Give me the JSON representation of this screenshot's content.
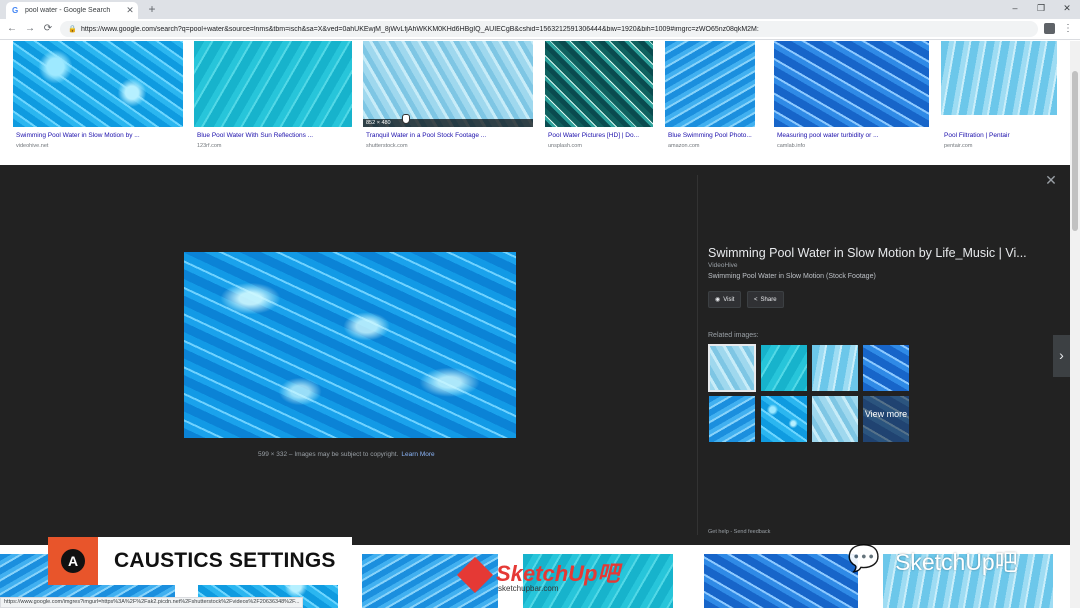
{
  "browser": {
    "tab_title": "pool water - Google Search",
    "tab_favicon": "G",
    "new_tab": "+",
    "url": "https://www.google.com/search?q=pool+water&source=lnms&tbm=isch&sa=X&ved=0ahUKEwjM_8jWvLfjAhWKKM0KHd6HBgIQ_AUIECgB&cshid=1563212591306444&biw=1920&bih=1009#imgrc=zWO65nz08qkM2M:",
    "window": {
      "minimize": "–",
      "restore": "❐",
      "close": "✕"
    },
    "nav": {
      "back": "←",
      "forward": "→",
      "reload": "⟳"
    }
  },
  "results": [
    {
      "title": "Swimming Pool Water in Slow Motion by ...",
      "source": "videohive.net"
    },
    {
      "title": "Blue Pool Water With Sun Reflections ...",
      "source": "123rf.com"
    },
    {
      "title": "Tranquil Water in a Pool Stock Footage ...",
      "source": "shutterstock.com",
      "dims": "852 × 480"
    },
    {
      "title": "Pool Water Pictures [HD] | Do...",
      "source": "unsplash.com"
    },
    {
      "title": "Blue Swimming Pool Photo...",
      "source": "amazon.com"
    },
    {
      "title": "Measuring pool water turbidity or ...",
      "source": "camlab.info"
    },
    {
      "title": "Pool Filtration | Pentair",
      "source": "pentair.com"
    }
  ],
  "preview": {
    "close": "✕",
    "dims": "599 × 332",
    "copyright": " – Images may be subject to copyright.",
    "learn_more": "Learn More",
    "title": "Swimming Pool Water in Slow Motion by Life_Music | Vi...",
    "source": "VideoHive",
    "description": "Swimming Pool Water in Slow Motion (Stock Footage)",
    "visit_label": "Visit",
    "share_label": "Share",
    "related_label": "Related images:",
    "view_more": "View more",
    "footer": "Get help  -  Send feedback",
    "next": "›"
  },
  "status_bar": "https://www.google.com/imgres?imgurl=https%3A%2F%2Fak2.picdn.net%2Fshutterstock%2Fvideos%2F20636348%2F...",
  "overlay": {
    "banner_logo": "A",
    "banner_text": "CAUSTICS SETTINGS",
    "sketchup_name": "SketchUp吧",
    "sketchup_url": "sketchupbar.com",
    "watermark": "SketchUp吧"
  },
  "colors": {
    "panel_bg": "#222222",
    "accent_orange": "#e8552b",
    "accent_red": "#e53935",
    "link_blue": "#1a0dab"
  }
}
